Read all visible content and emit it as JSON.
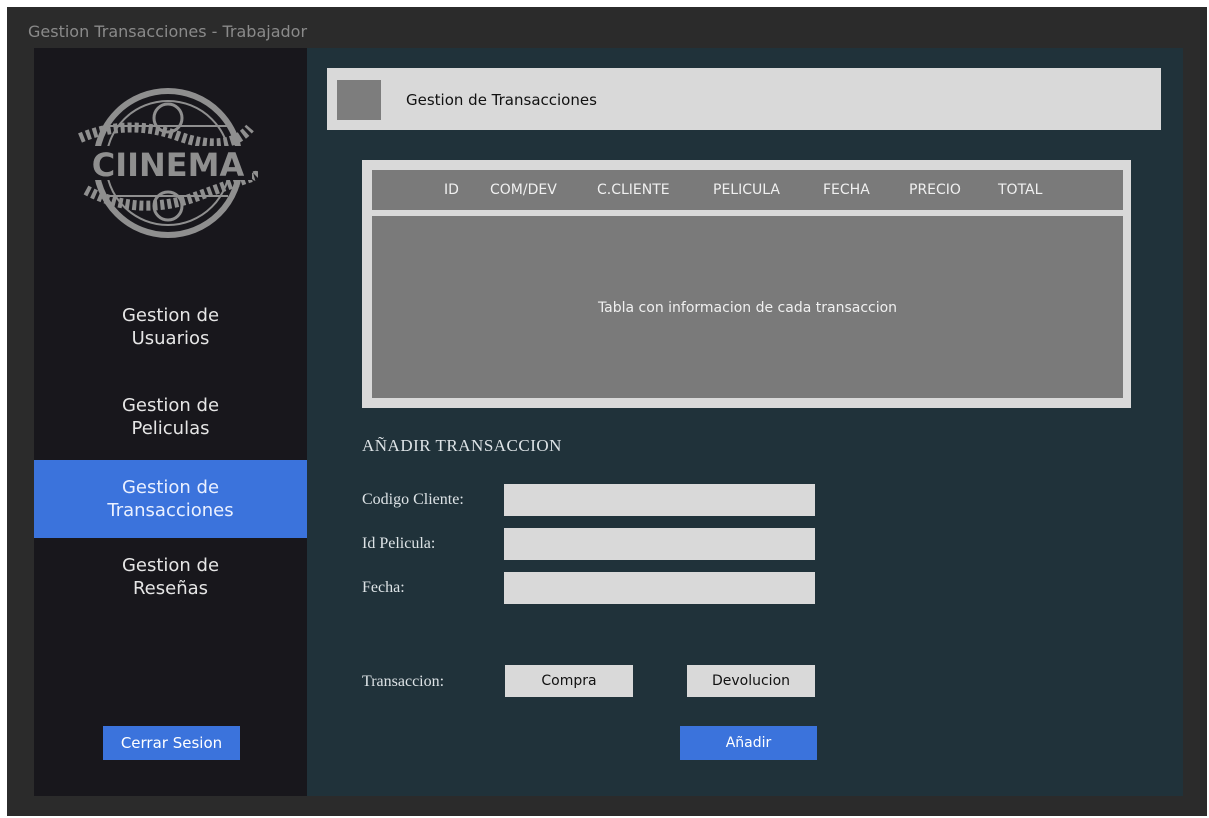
{
  "window": {
    "title": "Gestion Transacciones - Trabajador"
  },
  "sidebar": {
    "logo_text": "CIINEMA",
    "items": [
      {
        "label": "Gestion de\nUsuarios",
        "active": false
      },
      {
        "label": "Gestion de\nPeliculas",
        "active": false
      },
      {
        "label": "Gestion de\nTransacciones",
        "active": true
      },
      {
        "label": "Gestion de\nReseñas",
        "active": false
      }
    ],
    "logout_label": "Cerrar Sesion"
  },
  "header": {
    "title": "Gestion de Transacciones"
  },
  "table": {
    "columns": [
      "ID",
      "COM/DEV",
      "C.CLIENTE",
      "PELICULA",
      "FECHA",
      "PRECIO",
      "TOTAL"
    ],
    "placeholder": "Tabla con informacion de cada transaccion"
  },
  "form": {
    "section_title": "AÑADIR TRANSACCION",
    "fields": [
      {
        "label": "Codigo Cliente:",
        "value": ""
      },
      {
        "label": "Id Pelicula:",
        "value": ""
      },
      {
        "label": "Fecha:",
        "value": ""
      }
    ],
    "transaction_label": "Transaccion:",
    "buy_label": "Compra",
    "return_label": "Devolucion",
    "submit_label": "Añadir"
  },
  "colors": {
    "accent": "#3b73dc",
    "sidebar_bg": "#18171c",
    "main_bg": "#20323a",
    "panel_gray": "#d9d9d9",
    "table_gray": "#7a7a7a"
  }
}
